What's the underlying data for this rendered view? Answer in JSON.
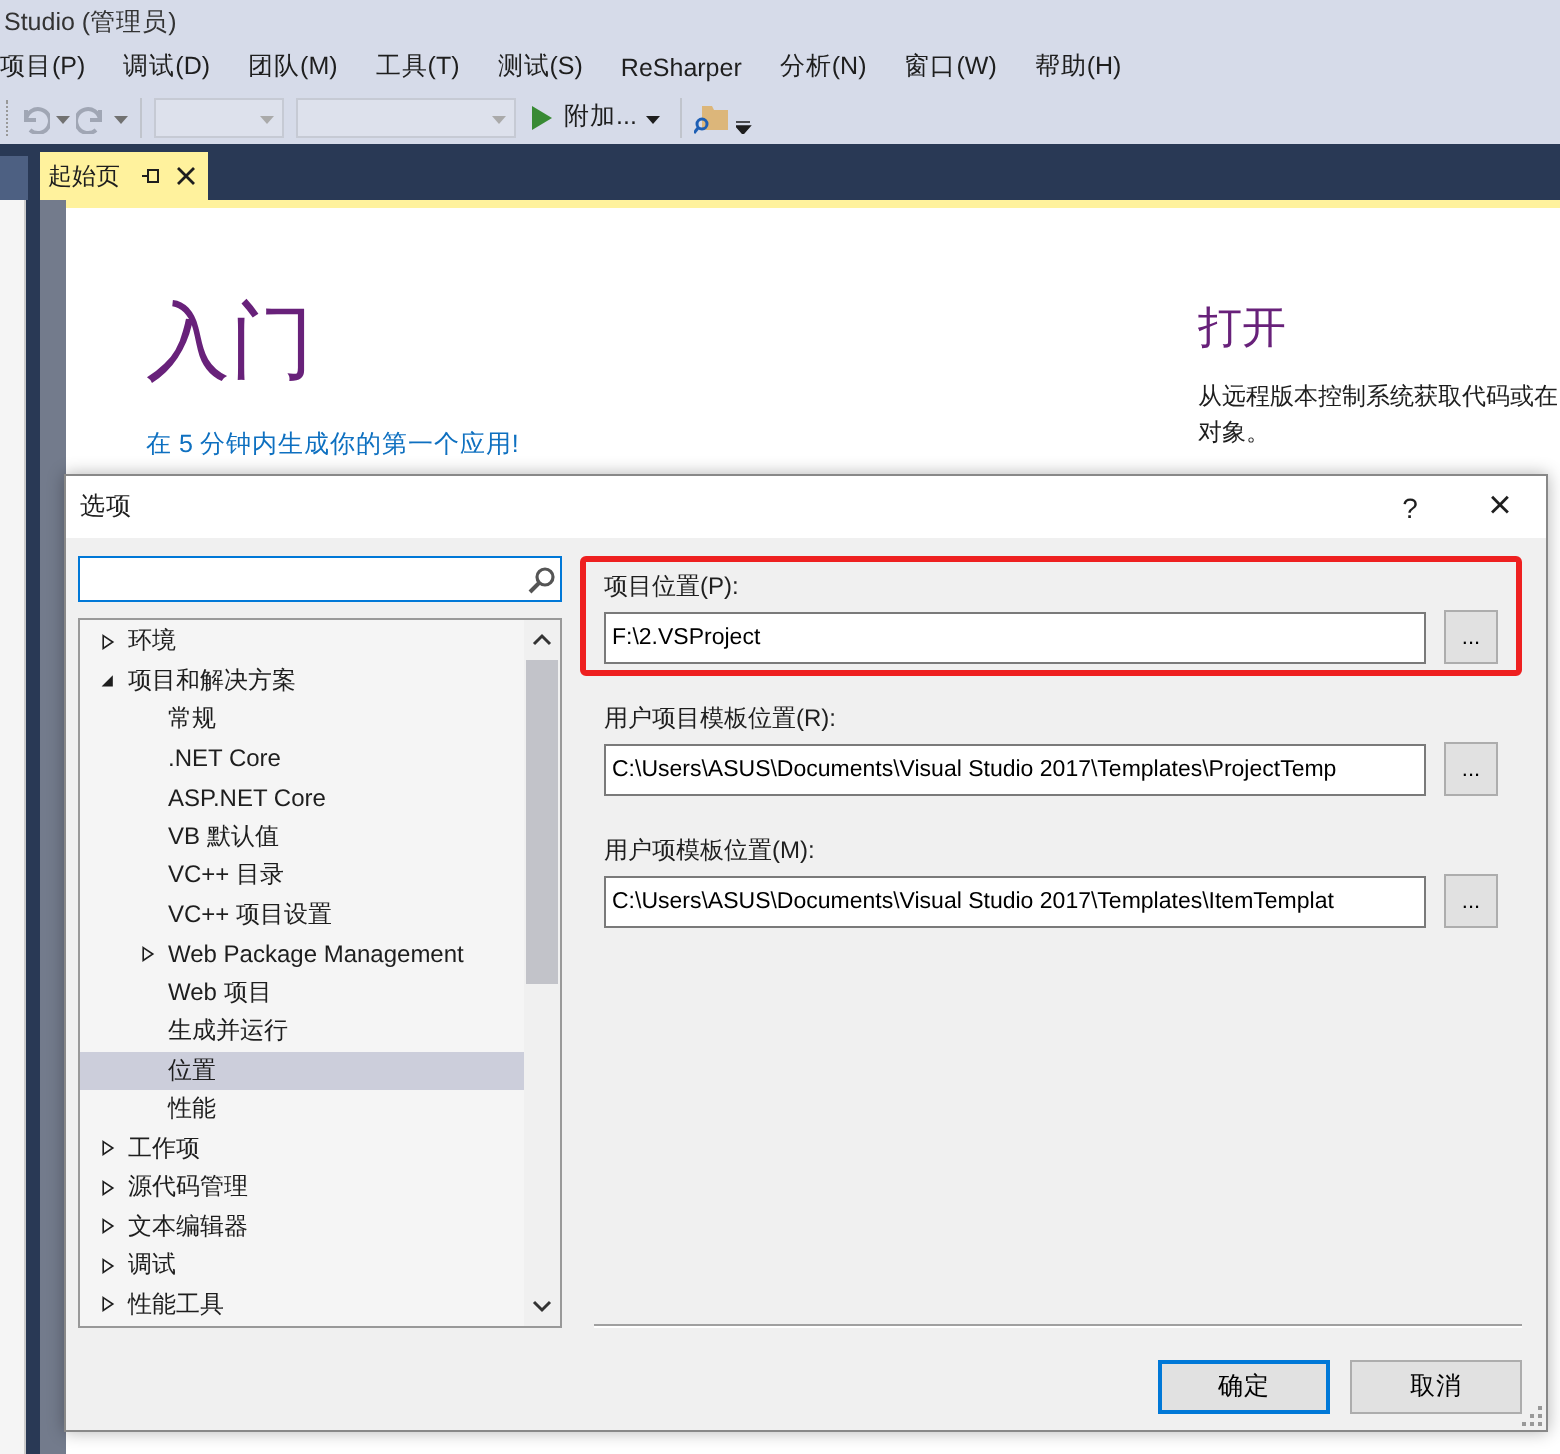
{
  "window": {
    "title": "Studio (管理员)"
  },
  "menu": [
    "项目(P)",
    "调试(D)",
    "团队(M)",
    "工具(T)",
    "测试(S)",
    "ReSharper",
    "分析(N)",
    "窗口(W)",
    "帮助(H)"
  ],
  "toolbar": {
    "attach_label": "附加..."
  },
  "tabs": [
    {
      "label": "起始页",
      "selected": true
    }
  ],
  "start_page": {
    "heading": "入门",
    "link": "在 5 分钟内生成你的第一个应用!",
    "open_heading": "打开",
    "open_lines": [
      "从远程版本控制系统获取代码或在",
      "对象。"
    ]
  },
  "dialog": {
    "title": "选项",
    "help": "?",
    "close": "×",
    "tree": [
      {
        "label": "环境",
        "expanded": false,
        "selected": false
      },
      {
        "label": "项目和解决方案",
        "expanded": true,
        "selected": false,
        "children": [
          {
            "label": "常规",
            "selected": false
          },
          {
            "label": ".NET Core",
            "selected": false
          },
          {
            "label": "ASP.NET Core",
            "selected": false
          },
          {
            "label": "VB 默认值",
            "selected": false
          },
          {
            "label": "VC++ 目录",
            "selected": false
          },
          {
            "label": "VC++ 项目设置",
            "selected": false
          },
          {
            "label": "Web Package Management",
            "expanded": false,
            "selected": false
          },
          {
            "label": "Web 项目",
            "selected": false
          },
          {
            "label": "生成并运行",
            "selected": false
          },
          {
            "label": "位置",
            "selected": true
          },
          {
            "label": "性能",
            "selected": false
          }
        ]
      },
      {
        "label": "工作项",
        "expanded": false,
        "selected": false
      },
      {
        "label": "源代码管理",
        "expanded": false,
        "selected": false
      },
      {
        "label": "文本编辑器",
        "expanded": false,
        "selected": false
      },
      {
        "label": "调试",
        "expanded": false,
        "selected": false
      },
      {
        "label": "性能工具",
        "expanded": false,
        "selected": false
      }
    ],
    "fields": [
      {
        "label": "项目位置(P):",
        "value": "F:\\2.VSProject",
        "highlighted": true,
        "browse": "..."
      },
      {
        "label": "用户项目模板位置(R):",
        "value": "C:\\Users\\ASUS\\Documents\\Visual Studio 2017\\Templates\\ProjectTemp",
        "highlighted": false,
        "browse": "..."
      },
      {
        "label": "用户项模板位置(M):",
        "value": "C:\\Users\\ASUS\\Documents\\Visual Studio 2017\\Templates\\ItemTemplat",
        "highlighted": false,
        "browse": "..."
      }
    ],
    "buttons": [
      {
        "label": "确定",
        "default": true
      },
      {
        "label": "取消",
        "default": false
      }
    ]
  }
}
